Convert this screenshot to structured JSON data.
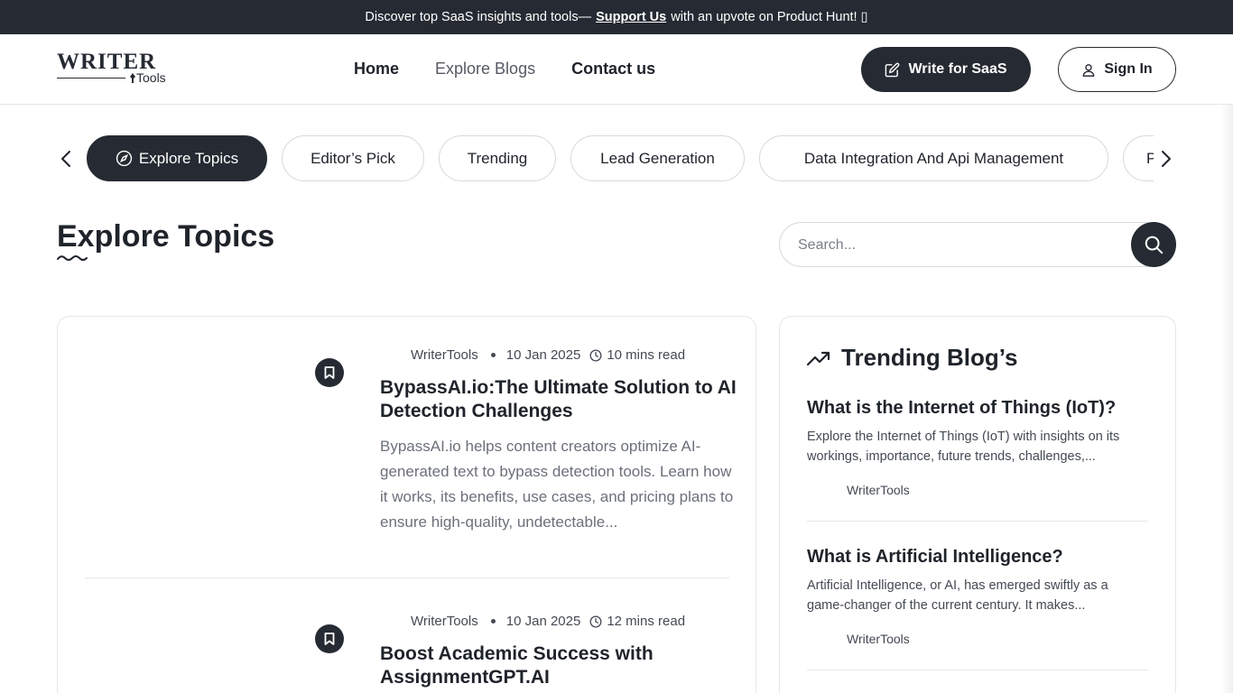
{
  "announcement": {
    "text_before": "Discover top SaaS insights and tools—",
    "link": "Support Us",
    "text_after": "with an upvote on Product Hunt! ▯"
  },
  "logo": {
    "main": "WRITER",
    "sub": "Tools"
  },
  "nav": {
    "home": "Home",
    "explore": "Explore Blogs",
    "contact": "Contact us"
  },
  "buttons": {
    "write": "Write for SaaS",
    "sign_in": "Sign In"
  },
  "topics": [
    "Explore Topics",
    "Editor’s Pick",
    "Trending",
    "Lead Generation",
    "Data Integration And Api Management",
    "P"
  ],
  "page_title": "Explore Topics",
  "search": {
    "placeholder": "Search..."
  },
  "posts": [
    {
      "author": "WriterTools",
      "date": "10 Jan 2025",
      "read": "10 mins read",
      "title": "BypassAI.io:The Ultimate Solution to AI Detection Challenges",
      "excerpt": "BypassAI.io helps content creators optimize AI-generated text to bypass detection tools. Learn how it works, its benefits, use cases, and pricing plans to ensure high-quality, undetectable..."
    },
    {
      "author": "WriterTools",
      "date": "10 Jan 2025",
      "read": "12 mins read",
      "title": "Boost Academic Success with AssignmentGPT.AI",
      "excerpt": ""
    }
  ],
  "trending": {
    "title": "Trending Blog’s",
    "items": [
      {
        "title": "What is the Internet of Things (IoT)?",
        "excerpt": "Explore the Internet of Things (IoT) with insights on its workings, importance, future trends, challenges,...",
        "author": "WriterTools"
      },
      {
        "title": "What is Artificial Intelligence?",
        "excerpt": "Artificial Intelligence, or AI, has emerged swiftly as a game-changer of the current century. It makes...",
        "author": "WriterTools"
      }
    ]
  },
  "colors": {
    "dark": "#262b33",
    "text": "#1f232a",
    "muted": "#6b7079",
    "border": "#e4e6ea"
  }
}
